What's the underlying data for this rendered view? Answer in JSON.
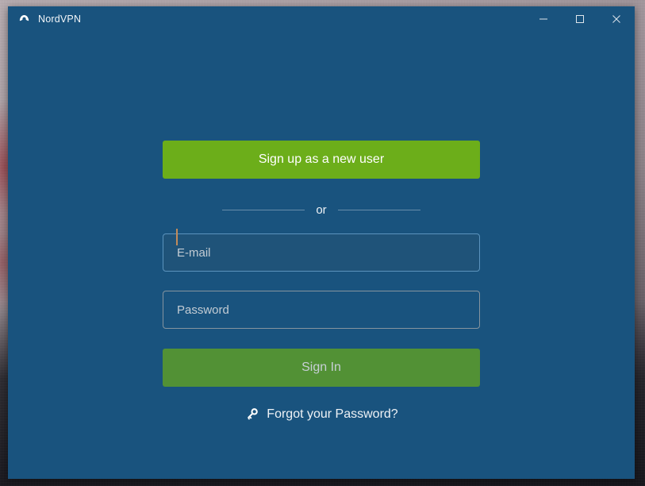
{
  "window": {
    "app_title": "NordVPN",
    "logo_icon": "nordvpn-arch-logo",
    "controls": {
      "minimize_icon": "minimize-icon",
      "maximize_icon": "maximize-icon",
      "close_icon": "close-icon"
    }
  },
  "login": {
    "signup_label": "Sign up as a new user",
    "or_label": "or",
    "email_placeholder": "E-mail",
    "email_value": "",
    "password_placeholder": "Password",
    "password_value": "",
    "signin_label": "Sign In",
    "forgot_label": "Forgot your Password?",
    "forgot_icon": "key-icon"
  },
  "colors": {
    "window_background": "#19537e",
    "signup_green": "#6cae1a",
    "signin_green": "#529135",
    "email_field_background": "#1f5379",
    "email_field_border": "#5b93bd",
    "password_field_border": "#85949f",
    "caret": "#c28b5a",
    "text_primary": "#ffffff",
    "placeholder": "#c3ccd4",
    "signin_text": "#c7cfd6"
  }
}
